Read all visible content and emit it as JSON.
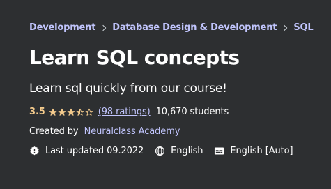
{
  "breadcrumb": {
    "items": [
      "Development",
      "Database Design & Development",
      "SQL"
    ]
  },
  "course": {
    "title": "Learn SQL concepts",
    "subtitle": "Learn sql quickly from our course!"
  },
  "rating": {
    "value": "3.5",
    "stars": 3.5,
    "max_stars": 5,
    "ratings_link": "(98 ratings)",
    "students": "10,670 students"
  },
  "instructor": {
    "label": "Created by",
    "name": "Neuralclass Academy"
  },
  "meta": {
    "last_updated": "Last updated 09.2022",
    "language": "English",
    "captions": "English [Auto]"
  },
  "icons": {
    "update": "alert-badge-icon",
    "language": "globe-icon",
    "captions": "closed-captions-icon"
  },
  "colors": {
    "background": "#2d2f31",
    "link": "#c0c4fc",
    "rating": "#f3ca8c",
    "text": "#ffffff"
  }
}
